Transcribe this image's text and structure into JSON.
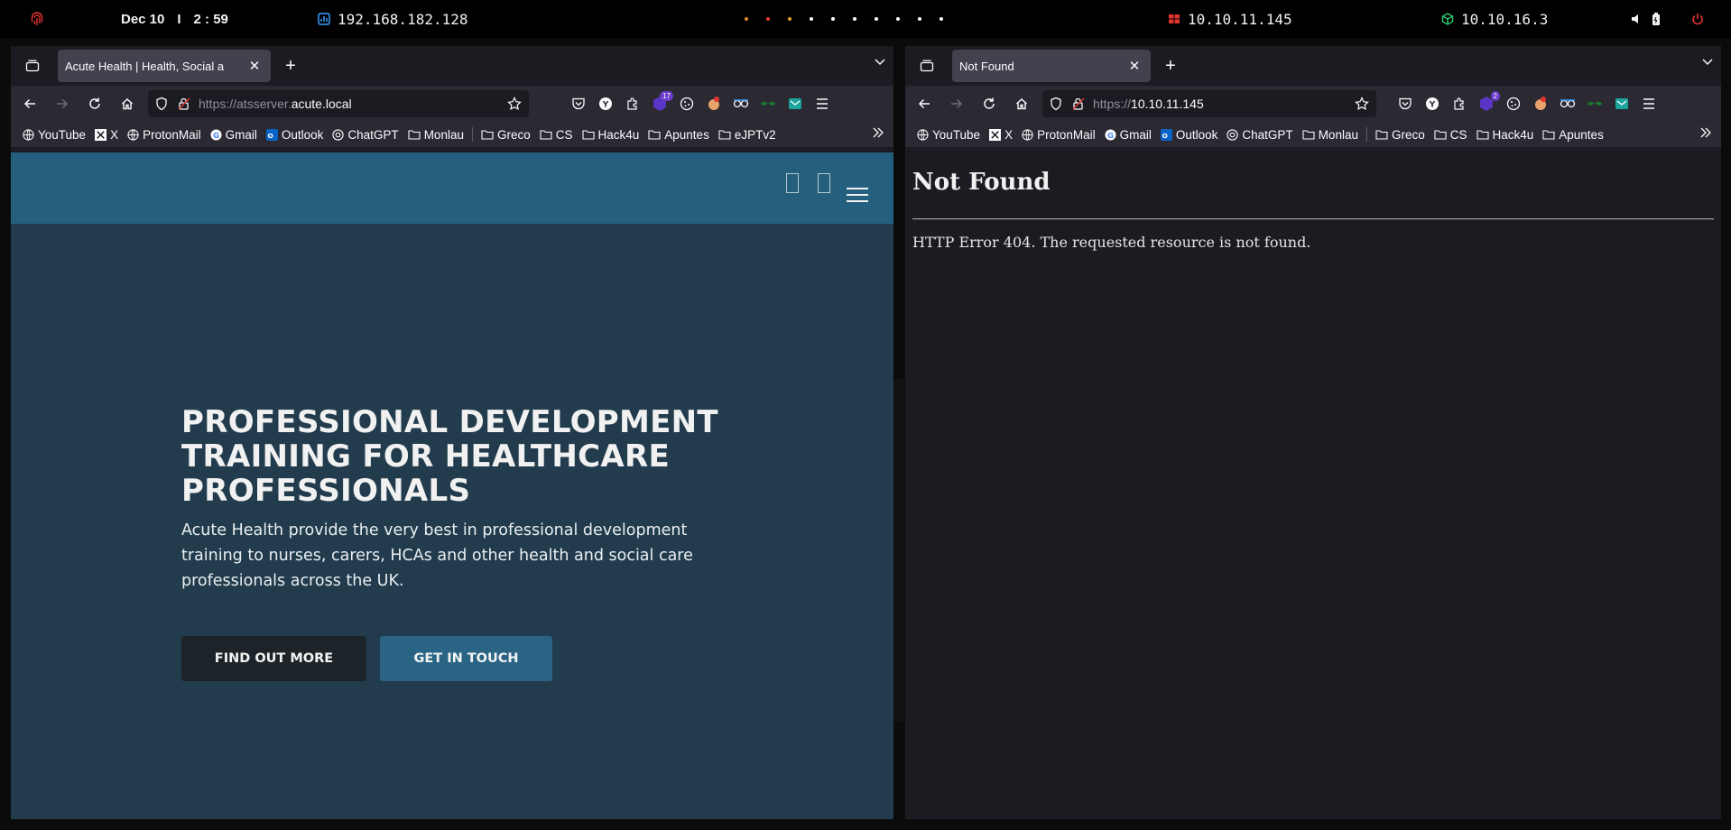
{
  "system_bar": {
    "date": "Dec 10",
    "separator": "I",
    "time": "2 : 59",
    "vpn_ip": "192.168.182.128",
    "target_ip": "10.10.11.145",
    "local_ip": "10.10.16.3",
    "workspace_dot_colors": [
      "#e0872a",
      "#e33c2e",
      "#e0a12a",
      "#ffffff",
      "#ffffff",
      "#ffffff",
      "#ffffff",
      "#ffffff",
      "#ffffff",
      "#ffffff"
    ],
    "accent_red": "#e3342f",
    "accent_green": "#2ecc71",
    "accent_blue": "#3aa0ff"
  },
  "left_browser": {
    "tab": {
      "title": "Acute Health | Health, Social a",
      "close": "✕"
    },
    "new_tab": "+",
    "url": {
      "prefix": "https://atsserver.",
      "domain": "acute.local"
    },
    "badges": {
      "ext_count": "17"
    },
    "bookmarks": [
      "YouTube",
      "X",
      "ProtonMail",
      "Gmail",
      "Outlook",
      "ChatGPT",
      "Monlau",
      "Greco",
      "CS",
      "Hack4u",
      "Apuntes",
      "eJPTv2"
    ],
    "header_icons": [
      "   ",
      "   "
    ],
    "hero": {
      "title": "PROFESSIONAL DEVELOPMENT TRAINING FOR HEALTHCARE PROFESSIONALS",
      "text": "Acute Health provide the very best in professional development training to nurses, carers, HCAs and other health and social care professionals across the UK.",
      "button_primary": "FIND OUT MORE",
      "button_secondary": "GET IN TOUCH"
    },
    "colors": {
      "header": "#24607e",
      "hero_bg": "#223c4d",
      "btn_dark": "#1d2429",
      "btn_blue": "#2a6485"
    }
  },
  "right_browser": {
    "tab": {
      "title": "Not Found",
      "close": "✕"
    },
    "new_tab": "+",
    "url": {
      "prefix": "https://",
      "domain": "10.10.11.145"
    },
    "badges": {
      "ext_count": "2"
    },
    "bookmarks": [
      "YouTube",
      "X",
      "ProtonMail",
      "Gmail",
      "Outlook",
      "ChatGPT",
      "Monlau",
      "Greco",
      "CS",
      "Hack4u",
      "Apuntes"
    ],
    "page": {
      "heading": "Not Found",
      "message": "HTTP Error 404. The requested resource is not found."
    }
  }
}
